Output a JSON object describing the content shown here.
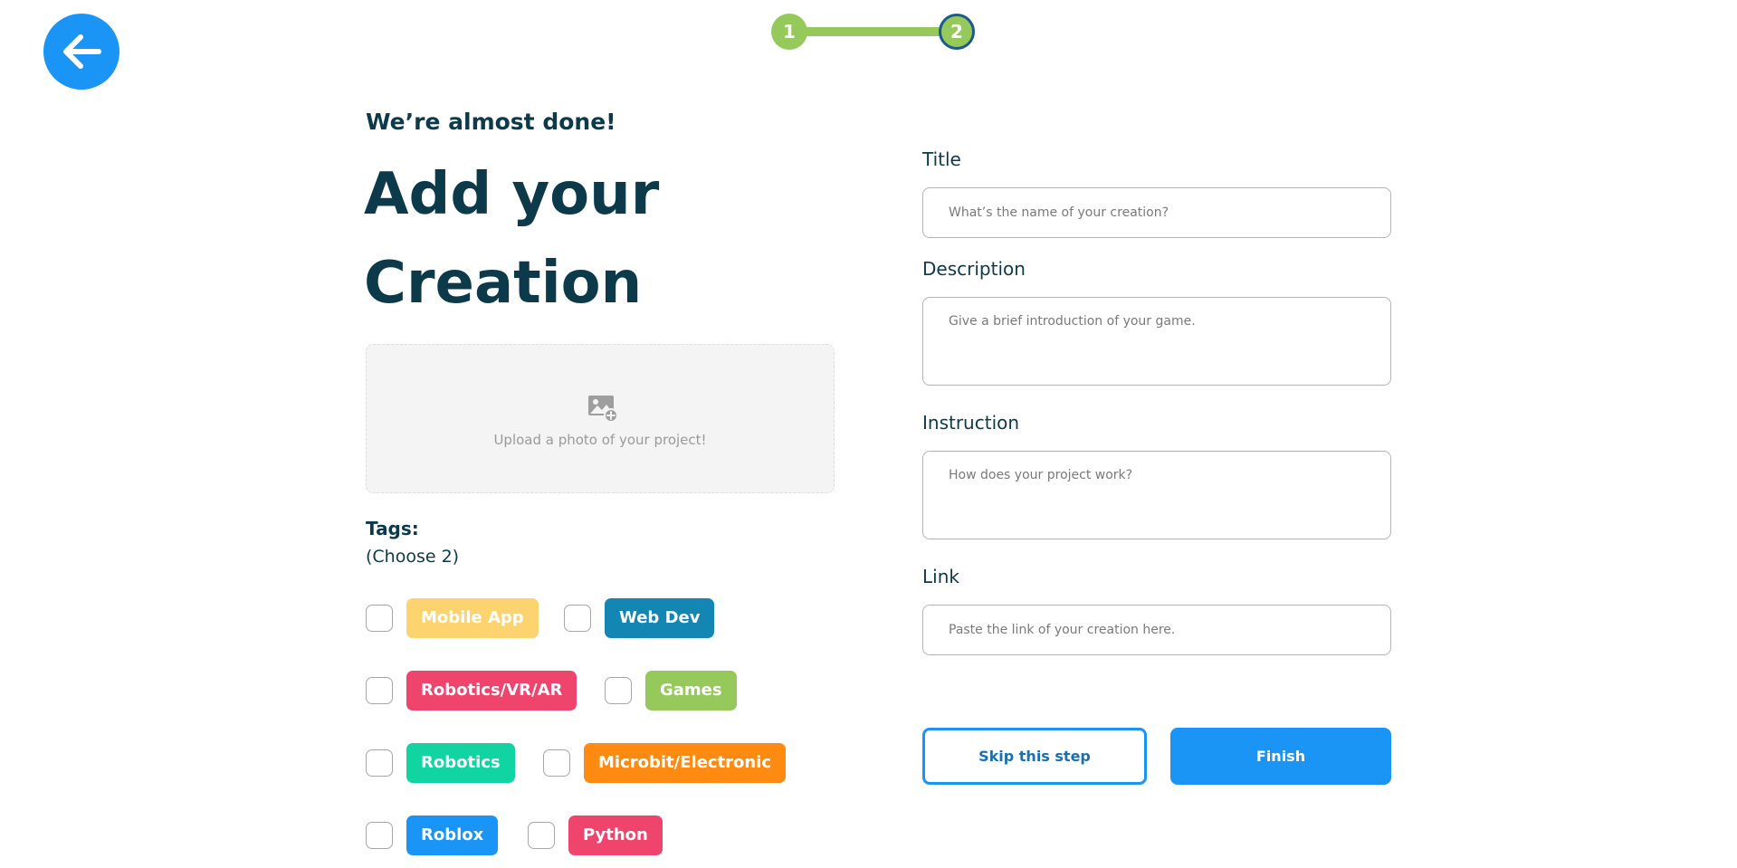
{
  "nav": {
    "back_icon": "arrow-left-icon"
  },
  "stepper": {
    "steps": [
      "1",
      "2"
    ],
    "current_step": 2,
    "colors": {
      "complete": "#95c95b",
      "current_ring": "#1a5b8a"
    }
  },
  "header": {
    "subtitle": "We’re almost done!",
    "title": "Add your Creation"
  },
  "upload": {
    "icon": "add-photo-icon",
    "text": "Upload a photo of your project!"
  },
  "tags": {
    "label": "Tags:",
    "hint": "(Choose 2)",
    "items": [
      {
        "label": "Mobile App",
        "color": "#fdd36f",
        "checked": false
      },
      {
        "label": "Web Dev",
        "color": "#1386b3",
        "checked": false
      },
      {
        "label": "Robotics/VR/AR",
        "color": "#ef456d",
        "checked": false
      },
      {
        "label": "Games",
        "color": "#95c95b",
        "checked": false
      },
      {
        "label": "Robotics",
        "color": "#10d4a1",
        "checked": false
      },
      {
        "label": "Microbit/Electronic",
        "color": "#fe8a12",
        "checked": false
      },
      {
        "label": "Roblox",
        "color": "#1a94f5",
        "checked": false
      },
      {
        "label": "Python",
        "color": "#ef456d",
        "checked": false
      }
    ]
  },
  "form": {
    "title": {
      "label": "Title",
      "value": "",
      "placeholder": "What’s the name of your creation?"
    },
    "description": {
      "label": "Description",
      "value": "",
      "placeholder": "Give a brief introduction of your game."
    },
    "instruction": {
      "label": "Instruction",
      "value": "",
      "placeholder": "How does your project work?"
    },
    "link": {
      "label": "Link",
      "value": "",
      "placeholder": "Paste the link of your creation here."
    }
  },
  "actions": {
    "skip_label": "Skip this step",
    "finish_label": "Finish"
  },
  "colors": {
    "primary": "#1a94f5",
    "heading": "#0d3a4a"
  }
}
